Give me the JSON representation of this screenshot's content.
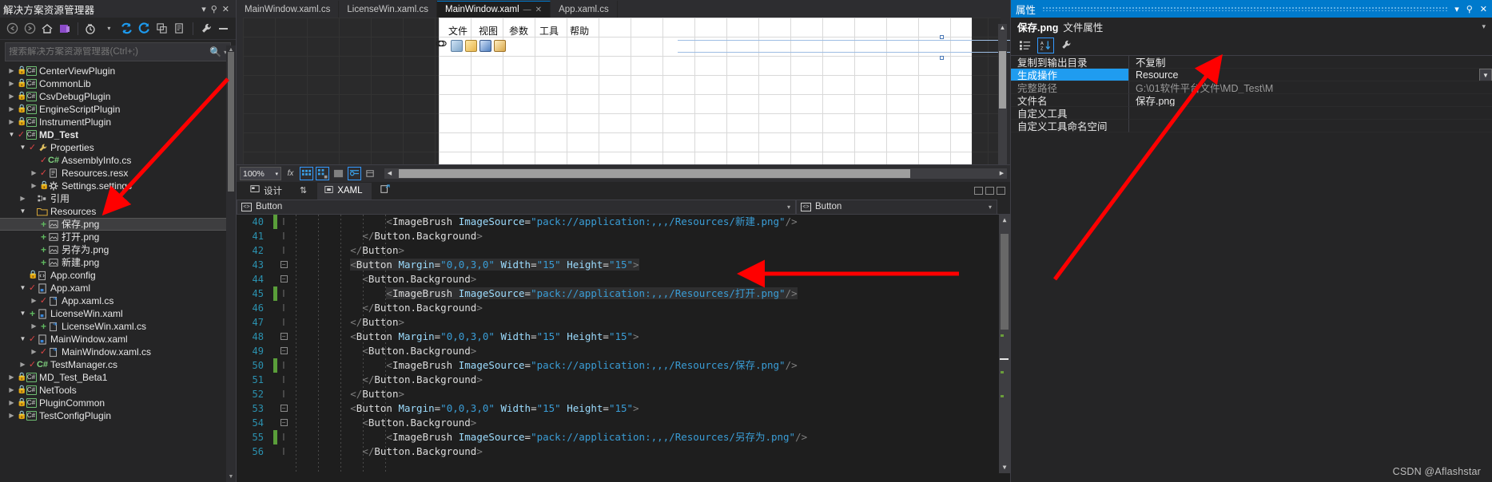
{
  "solution_explorer": {
    "title": "解决方案资源管理器",
    "window_buttons": [
      "▼",
      "⚲",
      "✕"
    ],
    "toolbar_icons": [
      "back-arrow-icon",
      "forward-arrow-icon",
      "home-icon",
      "solution-view-icon",
      "pending-changes-icon",
      "dropdown-icon",
      "sync-icon",
      "refresh-icon",
      "collapse-all-icon",
      "properties-page-icon",
      "wrench-icon",
      "minus-icon"
    ],
    "search_placeholder": "搜索解决方案资源管理器(Ctrl+;)",
    "tree": [
      {
        "label": "CenterViewPlugin",
        "indent": 0,
        "twisty": "right",
        "badge": "lock",
        "icon": "cs-project",
        "bold": false,
        "selected": false
      },
      {
        "label": "CommonLib",
        "indent": 0,
        "twisty": "right",
        "badge": "lock",
        "icon": "cs-project",
        "bold": false,
        "selected": false
      },
      {
        "label": "CsvDebugPlugin",
        "indent": 0,
        "twisty": "right",
        "badge": "lock",
        "icon": "cs-project",
        "bold": false,
        "selected": false
      },
      {
        "label": "EngineScriptPlugin",
        "indent": 0,
        "twisty": "right",
        "badge": "lock",
        "icon": "cs-project",
        "bold": false,
        "selected": false
      },
      {
        "label": "InstrumentPlugin",
        "indent": 0,
        "twisty": "right",
        "badge": "lock",
        "icon": "cs-project",
        "bold": false,
        "selected": false
      },
      {
        "label": "MD_Test",
        "indent": 0,
        "twisty": "down",
        "badge": "check",
        "icon": "cs-project",
        "bold": true,
        "selected": false
      },
      {
        "label": "Properties",
        "indent": 1,
        "twisty": "down",
        "badge": "check",
        "icon": "wrench",
        "bold": false,
        "selected": false
      },
      {
        "label": "AssemblyInfo.cs",
        "indent": 2,
        "twisty": "none",
        "badge": "check",
        "icon": "cs-file",
        "bold": false,
        "selected": false
      },
      {
        "label": "Resources.resx",
        "indent": 2,
        "twisty": "right",
        "badge": "check",
        "icon": "resx",
        "bold": false,
        "selected": false
      },
      {
        "label": "Settings.settings",
        "indent": 2,
        "twisty": "right",
        "badge": "lock",
        "icon": "gear",
        "bold": false,
        "selected": false
      },
      {
        "label": "引用",
        "indent": 1,
        "twisty": "right",
        "badge": "none",
        "icon": "references",
        "bold": false,
        "selected": false
      },
      {
        "label": "Resources",
        "indent": 1,
        "twisty": "down",
        "badge": "none",
        "icon": "folder",
        "bold": false,
        "selected": false
      },
      {
        "label": "保存.png",
        "indent": 2,
        "twisty": "none",
        "badge": "plus",
        "icon": "image",
        "bold": false,
        "selected": true
      },
      {
        "label": "打开.png",
        "indent": 2,
        "twisty": "none",
        "badge": "plus",
        "icon": "image",
        "bold": false,
        "selected": false
      },
      {
        "label": "另存为.png",
        "indent": 2,
        "twisty": "none",
        "badge": "plus",
        "icon": "image",
        "bold": false,
        "selected": false
      },
      {
        "label": "新建.png",
        "indent": 2,
        "twisty": "none",
        "badge": "plus",
        "icon": "image",
        "bold": false,
        "selected": false
      },
      {
        "label": "App.config",
        "indent": 1,
        "twisty": "none",
        "badge": "lock",
        "icon": "config",
        "bold": false,
        "selected": false
      },
      {
        "label": "App.xaml",
        "indent": 1,
        "twisty": "down",
        "badge": "check",
        "icon": "xaml",
        "bold": false,
        "selected": false
      },
      {
        "label": "App.xaml.cs",
        "indent": 2,
        "twisty": "right",
        "badge": "check",
        "icon": "csharp-code",
        "bold": false,
        "selected": false
      },
      {
        "label": "LicenseWin.xaml",
        "indent": 1,
        "twisty": "down",
        "badge": "plus",
        "icon": "xaml",
        "bold": false,
        "selected": false
      },
      {
        "label": "LicenseWin.xaml.cs",
        "indent": 2,
        "twisty": "right",
        "badge": "plus",
        "icon": "csharp-code",
        "bold": false,
        "selected": false
      },
      {
        "label": "MainWindow.xaml",
        "indent": 1,
        "twisty": "down",
        "badge": "check",
        "icon": "xaml",
        "bold": false,
        "selected": false
      },
      {
        "label": "MainWindow.xaml.cs",
        "indent": 2,
        "twisty": "right",
        "badge": "check",
        "icon": "csharp-code",
        "bold": false,
        "selected": false
      },
      {
        "label": "TestManager.cs",
        "indent": 1,
        "twisty": "right",
        "badge": "check",
        "icon": "cs-file",
        "bold": false,
        "selected": false
      },
      {
        "label": "MD_Test_Beta1",
        "indent": 0,
        "twisty": "right",
        "badge": "lock",
        "icon": "cs-project",
        "bold": false,
        "selected": false
      },
      {
        "label": "NetTools",
        "indent": 0,
        "twisty": "right",
        "badge": "lock",
        "icon": "cs-project",
        "bold": false,
        "selected": false
      },
      {
        "label": "PluginCommon",
        "indent": 0,
        "twisty": "right",
        "badge": "lock",
        "icon": "cs-project",
        "bold": false,
        "selected": false
      },
      {
        "label": "TestConfigPlugin",
        "indent": 0,
        "twisty": "right",
        "badge": "lock",
        "icon": "cs-project",
        "bold": false,
        "selected": false
      }
    ]
  },
  "editor": {
    "document_tabs": [
      {
        "label": "MainWindow.xaml.cs",
        "active": false
      },
      {
        "label": "LicenseWin.xaml.cs",
        "active": false
      },
      {
        "label": "MainWindow.xaml",
        "active": true
      },
      {
        "label": "App.xaml.cs",
        "active": false
      }
    ],
    "designer": {
      "menu_items": [
        "文件",
        "视图",
        "参数",
        "工具",
        "帮助"
      ],
      "toolbar_icons": [
        "new-icon",
        "open-icon",
        "save-icon",
        "save-as-icon"
      ],
      "zoom_level": "100%",
      "toolbar_buttons": [
        "fx-icon",
        "grid-icon",
        "snap-grid-icon",
        "effects-icon",
        "alignment-icon",
        "tag-icon"
      ]
    },
    "view_tabs": [
      {
        "label": "设计",
        "icon": "design-icon",
        "active": false
      },
      {
        "label": "",
        "icon": "swap-icon",
        "active": false
      },
      {
        "label": "XAML",
        "icon": "xaml-icon",
        "active": true
      },
      {
        "label": "",
        "icon": "popout-icon",
        "active": false
      }
    ],
    "context_left": "Button",
    "context_right": "Button",
    "code_lines": [
      {
        "num": "40",
        "indent": 8,
        "changed": true,
        "fold": "none",
        "highlight": false,
        "segments": [
          {
            "t": "<",
            "c": "brk"
          },
          {
            "t": "ImageBrush",
            "c": "tag"
          },
          {
            "t": " ",
            "c": "tag"
          },
          {
            "t": "ImageSource",
            "c": "attr"
          },
          {
            "t": "=",
            "c": "tag"
          },
          {
            "t": "\"pack://application:,,,/Resources/新建.png\"",
            "c": "str"
          },
          {
            "t": "/>",
            "c": "brk"
          }
        ]
      },
      {
        "num": "41",
        "indent": 6,
        "changed": false,
        "fold": "none",
        "highlight": false,
        "segments": [
          {
            "t": "</",
            "c": "brk"
          },
          {
            "t": "Button.Background",
            "c": "tag"
          },
          {
            "t": ">",
            "c": "brk"
          }
        ]
      },
      {
        "num": "42",
        "indent": 5,
        "changed": false,
        "fold": "none",
        "highlight": false,
        "segments": [
          {
            "t": "</",
            "c": "brk"
          },
          {
            "t": "Button",
            "c": "tag"
          },
          {
            "t": ">",
            "c": "brk"
          }
        ]
      },
      {
        "num": "43",
        "indent": 5,
        "changed": false,
        "fold": "minus",
        "highlight": true,
        "segments": [
          {
            "t": "<",
            "c": "brk"
          },
          {
            "t": "Button",
            "c": "tag"
          },
          {
            "t": " ",
            "c": "tag"
          },
          {
            "t": "Margin",
            "c": "attr"
          },
          {
            "t": "=",
            "c": "tag"
          },
          {
            "t": "\"0,0,3,0\"",
            "c": "str"
          },
          {
            "t": " ",
            "c": "tag"
          },
          {
            "t": "Width",
            "c": "attr"
          },
          {
            "t": "=",
            "c": "tag"
          },
          {
            "t": "\"15\"",
            "c": "str"
          },
          {
            "t": " ",
            "c": "tag"
          },
          {
            "t": "Height",
            "c": "attr"
          },
          {
            "t": "=",
            "c": "tag"
          },
          {
            "t": "\"15\"",
            "c": "str"
          },
          {
            "t": ">",
            "c": "brk"
          }
        ]
      },
      {
        "num": "44",
        "indent": 6,
        "changed": false,
        "fold": "minus",
        "highlight": false,
        "segments": [
          {
            "t": "<",
            "c": "brk"
          },
          {
            "t": "Button.Background",
            "c": "tag"
          },
          {
            "t": ">",
            "c": "brk"
          }
        ]
      },
      {
        "num": "45",
        "indent": 8,
        "changed": true,
        "fold": "none",
        "highlight": true,
        "segments": [
          {
            "t": "<",
            "c": "brk"
          },
          {
            "t": "ImageBrush",
            "c": "tag"
          },
          {
            "t": " ",
            "c": "tag"
          },
          {
            "t": "ImageSource",
            "c": "attr"
          },
          {
            "t": "=",
            "c": "tag"
          },
          {
            "t": "\"pack://application:,,,/Resources/打开.png\"",
            "c": "str"
          },
          {
            "t": "/>",
            "c": "brk"
          }
        ]
      },
      {
        "num": "46",
        "indent": 6,
        "changed": false,
        "fold": "none",
        "highlight": false,
        "segments": [
          {
            "t": "</",
            "c": "brk"
          },
          {
            "t": "Button.Background",
            "c": "tag"
          },
          {
            "t": ">",
            "c": "brk"
          }
        ]
      },
      {
        "num": "47",
        "indent": 5,
        "changed": false,
        "fold": "none",
        "highlight": false,
        "segments": [
          {
            "t": "</",
            "c": "brk"
          },
          {
            "t": "Button",
            "c": "tag"
          },
          {
            "t": ">",
            "c": "brk"
          }
        ]
      },
      {
        "num": "48",
        "indent": 5,
        "changed": false,
        "fold": "minus",
        "highlight": false,
        "segments": [
          {
            "t": "<",
            "c": "brk"
          },
          {
            "t": "Button",
            "c": "tag"
          },
          {
            "t": " ",
            "c": "tag"
          },
          {
            "t": "Margin",
            "c": "attr"
          },
          {
            "t": "=",
            "c": "tag"
          },
          {
            "t": "\"0,0,3,0\"",
            "c": "str"
          },
          {
            "t": " ",
            "c": "tag"
          },
          {
            "t": "Width",
            "c": "attr"
          },
          {
            "t": "=",
            "c": "tag"
          },
          {
            "t": "\"15\"",
            "c": "str"
          },
          {
            "t": " ",
            "c": "tag"
          },
          {
            "t": "Height",
            "c": "attr"
          },
          {
            "t": "=",
            "c": "tag"
          },
          {
            "t": "\"15\"",
            "c": "str"
          },
          {
            "t": ">",
            "c": "brk"
          }
        ]
      },
      {
        "num": "49",
        "indent": 6,
        "changed": false,
        "fold": "minus",
        "highlight": false,
        "segments": [
          {
            "t": "<",
            "c": "brk"
          },
          {
            "t": "Button.Background",
            "c": "tag"
          },
          {
            "t": ">",
            "c": "brk"
          }
        ]
      },
      {
        "num": "50",
        "indent": 8,
        "changed": true,
        "fold": "none",
        "highlight": false,
        "segments": [
          {
            "t": "<",
            "c": "brk"
          },
          {
            "t": "ImageBrush",
            "c": "tag"
          },
          {
            "t": " ",
            "c": "tag"
          },
          {
            "t": "ImageSource",
            "c": "attr"
          },
          {
            "t": "=",
            "c": "tag"
          },
          {
            "t": "\"pack://application:,,,/Resources/保存.png\"",
            "c": "str"
          },
          {
            "t": "/>",
            "c": "brk"
          }
        ]
      },
      {
        "num": "51",
        "indent": 6,
        "changed": false,
        "fold": "none",
        "highlight": false,
        "segments": [
          {
            "t": "</",
            "c": "brk"
          },
          {
            "t": "Button.Background",
            "c": "tag"
          },
          {
            "t": ">",
            "c": "brk"
          }
        ]
      },
      {
        "num": "52",
        "indent": 5,
        "changed": false,
        "fold": "none",
        "highlight": false,
        "segments": [
          {
            "t": "</",
            "c": "brk"
          },
          {
            "t": "Button",
            "c": "tag"
          },
          {
            "t": ">",
            "c": "brk"
          }
        ]
      },
      {
        "num": "53",
        "indent": 5,
        "changed": false,
        "fold": "minus",
        "highlight": false,
        "segments": [
          {
            "t": "<",
            "c": "brk"
          },
          {
            "t": "Button",
            "c": "tag"
          },
          {
            "t": " ",
            "c": "tag"
          },
          {
            "t": "Margin",
            "c": "attr"
          },
          {
            "t": "=",
            "c": "tag"
          },
          {
            "t": "\"0,0,3,0\"",
            "c": "str"
          },
          {
            "t": " ",
            "c": "tag"
          },
          {
            "t": "Width",
            "c": "attr"
          },
          {
            "t": "=",
            "c": "tag"
          },
          {
            "t": "\"15\"",
            "c": "str"
          },
          {
            "t": " ",
            "c": "tag"
          },
          {
            "t": "Height",
            "c": "attr"
          },
          {
            "t": "=",
            "c": "tag"
          },
          {
            "t": "\"15\"",
            "c": "str"
          },
          {
            "t": ">",
            "c": "brk"
          }
        ]
      },
      {
        "num": "54",
        "indent": 6,
        "changed": false,
        "fold": "minus",
        "highlight": false,
        "segments": [
          {
            "t": "<",
            "c": "brk"
          },
          {
            "t": "Button.Background",
            "c": "tag"
          },
          {
            "t": ">",
            "c": "brk"
          }
        ]
      },
      {
        "num": "55",
        "indent": 8,
        "changed": true,
        "fold": "none",
        "highlight": false,
        "segments": [
          {
            "t": "<",
            "c": "brk"
          },
          {
            "t": "ImageBrush",
            "c": "tag"
          },
          {
            "t": " ",
            "c": "tag"
          },
          {
            "t": "ImageSource",
            "c": "attr"
          },
          {
            "t": "=",
            "c": "tag"
          },
          {
            "t": "\"pack://application:,,,/Resources/另存为.png\"",
            "c": "str"
          },
          {
            "t": "/>",
            "c": "brk"
          }
        ]
      },
      {
        "num": "56",
        "indent": 6,
        "changed": false,
        "fold": "none",
        "highlight": false,
        "segments": [
          {
            "t": "</",
            "c": "brk"
          },
          {
            "t": "Button.Background",
            "c": "tag"
          },
          {
            "t": ">",
            "c": "brk"
          }
        ]
      }
    ]
  },
  "properties": {
    "title": "属性",
    "window_buttons": [
      "▼",
      "📌",
      "✕"
    ],
    "object_name": "保存.png",
    "object_kind": "文件属性",
    "toolbar_icons": [
      "categorized-icon",
      "alphabetical-icon",
      "property-pages-icon"
    ],
    "rows": [
      {
        "name": "复制到输出目录",
        "value": "不复制",
        "selected": false,
        "dim": false,
        "dropdown": false
      },
      {
        "name": "生成操作",
        "value": "Resource",
        "selected": true,
        "dim": false,
        "dropdown": true
      },
      {
        "name": "完整路径",
        "value": "G:\\01软件平台文件\\MD_Test\\M",
        "selected": false,
        "dim": true,
        "dropdown": false
      },
      {
        "name": "文件名",
        "value": "保存.png",
        "selected": false,
        "dim": false,
        "dropdown": false
      },
      {
        "name": "自定义工具",
        "value": "",
        "selected": false,
        "dim": false,
        "dropdown": false
      },
      {
        "name": "自定义工具命名空间",
        "value": "",
        "selected": false,
        "dim": false,
        "dropdown": false
      }
    ]
  },
  "watermark": "CSDN @Aflashstar",
  "colors": {
    "accent": "#007acc",
    "selection": "#1f9cf0",
    "arrow": "#ff0000",
    "string": "#3a9dd6",
    "line_number": "#2b91af"
  }
}
